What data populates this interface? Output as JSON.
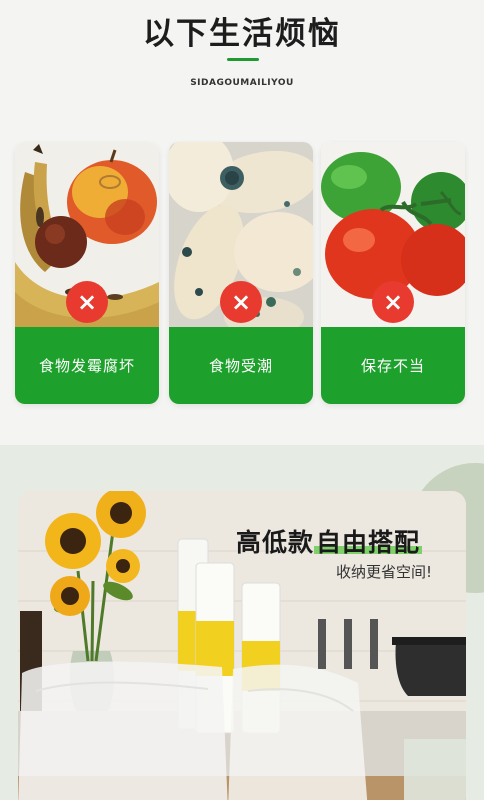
{
  "header": {
    "title": "以下生活烦恼",
    "subtitle": "SIDAGOUMAILIYOU"
  },
  "cards": [
    {
      "label": "食物发霉腐坏",
      "mark": "×"
    },
    {
      "label": "食物受潮",
      "mark": "×"
    },
    {
      "label": "保存不当",
      "mark": "×"
    }
  ],
  "promo": {
    "headline_plain": "高低款",
    "headline_highlight": "自由搭配",
    "subline": "收纳更省空间!"
  },
  "colors": {
    "green": "#1ea12c",
    "red": "#e83a2f"
  }
}
